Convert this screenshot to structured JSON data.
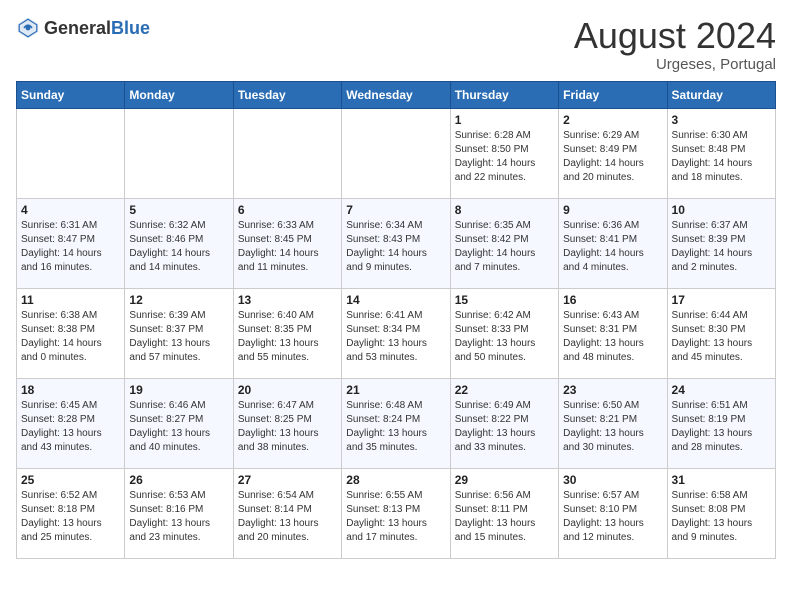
{
  "header": {
    "logo_general": "General",
    "logo_blue": "Blue",
    "main_title": "August 2024",
    "subtitle": "Urgeses, Portugal"
  },
  "days_of_week": [
    "Sunday",
    "Monday",
    "Tuesday",
    "Wednesday",
    "Thursday",
    "Friday",
    "Saturday"
  ],
  "weeks": [
    [
      {
        "day": "",
        "info": ""
      },
      {
        "day": "",
        "info": ""
      },
      {
        "day": "",
        "info": ""
      },
      {
        "day": "",
        "info": ""
      },
      {
        "day": "1",
        "info": "Sunrise: 6:28 AM\nSunset: 8:50 PM\nDaylight: 14 hours\nand 22 minutes."
      },
      {
        "day": "2",
        "info": "Sunrise: 6:29 AM\nSunset: 8:49 PM\nDaylight: 14 hours\nand 20 minutes."
      },
      {
        "day": "3",
        "info": "Sunrise: 6:30 AM\nSunset: 8:48 PM\nDaylight: 14 hours\nand 18 minutes."
      }
    ],
    [
      {
        "day": "4",
        "info": "Sunrise: 6:31 AM\nSunset: 8:47 PM\nDaylight: 14 hours\nand 16 minutes."
      },
      {
        "day": "5",
        "info": "Sunrise: 6:32 AM\nSunset: 8:46 PM\nDaylight: 14 hours\nand 14 minutes."
      },
      {
        "day": "6",
        "info": "Sunrise: 6:33 AM\nSunset: 8:45 PM\nDaylight: 14 hours\nand 11 minutes."
      },
      {
        "day": "7",
        "info": "Sunrise: 6:34 AM\nSunset: 8:43 PM\nDaylight: 14 hours\nand 9 minutes."
      },
      {
        "day": "8",
        "info": "Sunrise: 6:35 AM\nSunset: 8:42 PM\nDaylight: 14 hours\nand 7 minutes."
      },
      {
        "day": "9",
        "info": "Sunrise: 6:36 AM\nSunset: 8:41 PM\nDaylight: 14 hours\nand 4 minutes."
      },
      {
        "day": "10",
        "info": "Sunrise: 6:37 AM\nSunset: 8:39 PM\nDaylight: 14 hours\nand 2 minutes."
      }
    ],
    [
      {
        "day": "11",
        "info": "Sunrise: 6:38 AM\nSunset: 8:38 PM\nDaylight: 14 hours\nand 0 minutes."
      },
      {
        "day": "12",
        "info": "Sunrise: 6:39 AM\nSunset: 8:37 PM\nDaylight: 13 hours\nand 57 minutes."
      },
      {
        "day": "13",
        "info": "Sunrise: 6:40 AM\nSunset: 8:35 PM\nDaylight: 13 hours\nand 55 minutes."
      },
      {
        "day": "14",
        "info": "Sunrise: 6:41 AM\nSunset: 8:34 PM\nDaylight: 13 hours\nand 53 minutes."
      },
      {
        "day": "15",
        "info": "Sunrise: 6:42 AM\nSunset: 8:33 PM\nDaylight: 13 hours\nand 50 minutes."
      },
      {
        "day": "16",
        "info": "Sunrise: 6:43 AM\nSunset: 8:31 PM\nDaylight: 13 hours\nand 48 minutes."
      },
      {
        "day": "17",
        "info": "Sunrise: 6:44 AM\nSunset: 8:30 PM\nDaylight: 13 hours\nand 45 minutes."
      }
    ],
    [
      {
        "day": "18",
        "info": "Sunrise: 6:45 AM\nSunset: 8:28 PM\nDaylight: 13 hours\nand 43 minutes."
      },
      {
        "day": "19",
        "info": "Sunrise: 6:46 AM\nSunset: 8:27 PM\nDaylight: 13 hours\nand 40 minutes."
      },
      {
        "day": "20",
        "info": "Sunrise: 6:47 AM\nSunset: 8:25 PM\nDaylight: 13 hours\nand 38 minutes."
      },
      {
        "day": "21",
        "info": "Sunrise: 6:48 AM\nSunset: 8:24 PM\nDaylight: 13 hours\nand 35 minutes."
      },
      {
        "day": "22",
        "info": "Sunrise: 6:49 AM\nSunset: 8:22 PM\nDaylight: 13 hours\nand 33 minutes."
      },
      {
        "day": "23",
        "info": "Sunrise: 6:50 AM\nSunset: 8:21 PM\nDaylight: 13 hours\nand 30 minutes."
      },
      {
        "day": "24",
        "info": "Sunrise: 6:51 AM\nSunset: 8:19 PM\nDaylight: 13 hours\nand 28 minutes."
      }
    ],
    [
      {
        "day": "25",
        "info": "Sunrise: 6:52 AM\nSunset: 8:18 PM\nDaylight: 13 hours\nand 25 minutes."
      },
      {
        "day": "26",
        "info": "Sunrise: 6:53 AM\nSunset: 8:16 PM\nDaylight: 13 hours\nand 23 minutes."
      },
      {
        "day": "27",
        "info": "Sunrise: 6:54 AM\nSunset: 8:14 PM\nDaylight: 13 hours\nand 20 minutes."
      },
      {
        "day": "28",
        "info": "Sunrise: 6:55 AM\nSunset: 8:13 PM\nDaylight: 13 hours\nand 17 minutes."
      },
      {
        "day": "29",
        "info": "Sunrise: 6:56 AM\nSunset: 8:11 PM\nDaylight: 13 hours\nand 15 minutes."
      },
      {
        "day": "30",
        "info": "Sunrise: 6:57 AM\nSunset: 8:10 PM\nDaylight: 13 hours\nand 12 minutes."
      },
      {
        "day": "31",
        "info": "Sunrise: 6:58 AM\nSunset: 8:08 PM\nDaylight: 13 hours\nand 9 minutes."
      }
    ]
  ]
}
